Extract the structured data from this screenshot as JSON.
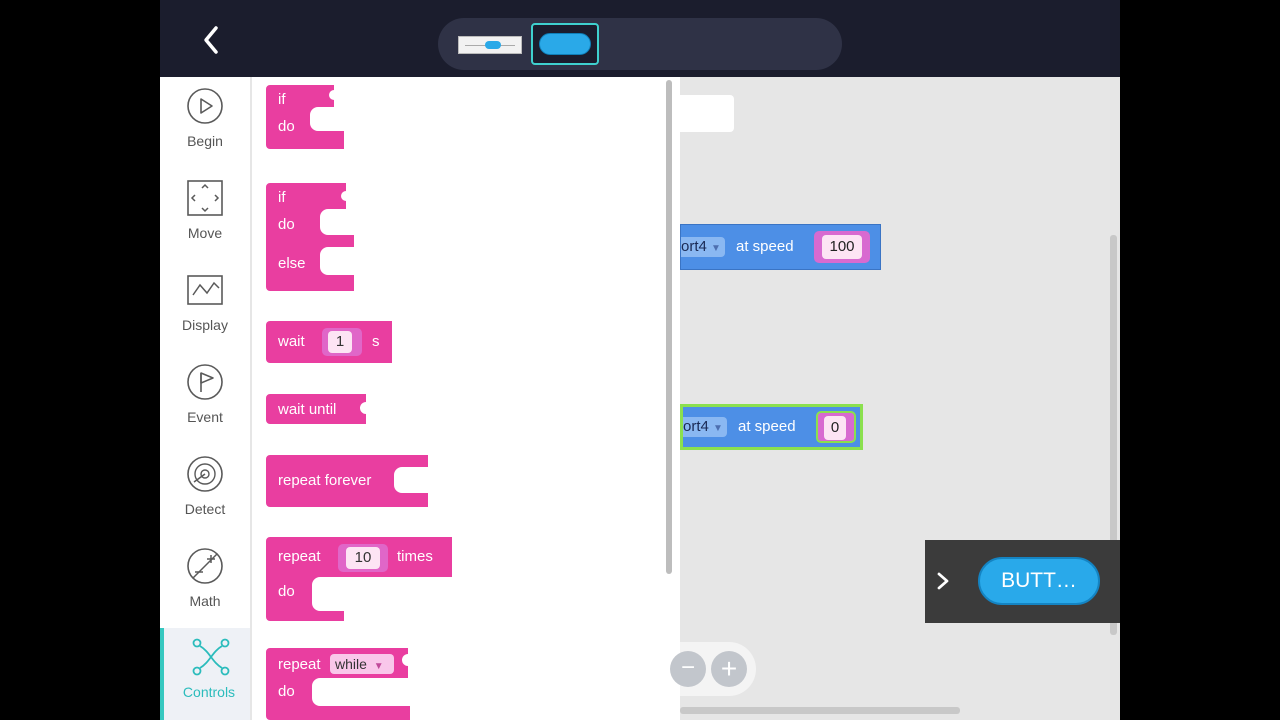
{
  "topbar": {
    "back_icon": "chevron-left-icon",
    "widgets": [
      {
        "name": "slider-widget-thumbnail"
      },
      {
        "name": "button-widget-thumbnail",
        "selected": true
      }
    ],
    "accent_color": "#3fd1cf"
  },
  "categories": [
    {
      "label": "Begin",
      "icon": "play-circle-icon"
    },
    {
      "label": "Move",
      "icon": "move-arrows-icon"
    },
    {
      "label": "Display",
      "icon": "display-wave-icon"
    },
    {
      "label": "Event",
      "icon": "flag-circle-icon"
    },
    {
      "label": "Detect",
      "icon": "radar-icon"
    },
    {
      "label": "Math",
      "icon": "math-icon"
    },
    {
      "label": "Controls",
      "icon": "controls-icon",
      "active": true
    }
  ],
  "flyout": {
    "block_color": "#e93ea0",
    "if_block": {
      "if": "if",
      "do": "do"
    },
    "if_else_block": {
      "if": "if",
      "do": "do",
      "else": "else"
    },
    "wait_block": {
      "label": "wait",
      "value": "1",
      "unit": "s"
    },
    "wait_until_block": {
      "label": "wait until"
    },
    "repeat_forever_block": {
      "label": "repeat forever"
    },
    "repeat_times_block": {
      "label": "repeat",
      "value": "10",
      "suffix": "times",
      "do": "do"
    },
    "repeat_while_block": {
      "label": "repeat",
      "mode": "while",
      "do": "do"
    }
  },
  "workspace": {
    "blocks": [
      {
        "port": "ort4",
        "speed_label": "at speed",
        "value": "100"
      },
      {
        "port": "ort4",
        "speed_label": "at speed",
        "value": "0",
        "selected": true
      }
    ],
    "zoom_out": "−",
    "zoom_in": "+"
  },
  "preview": {
    "button_label": "BUTT…"
  }
}
